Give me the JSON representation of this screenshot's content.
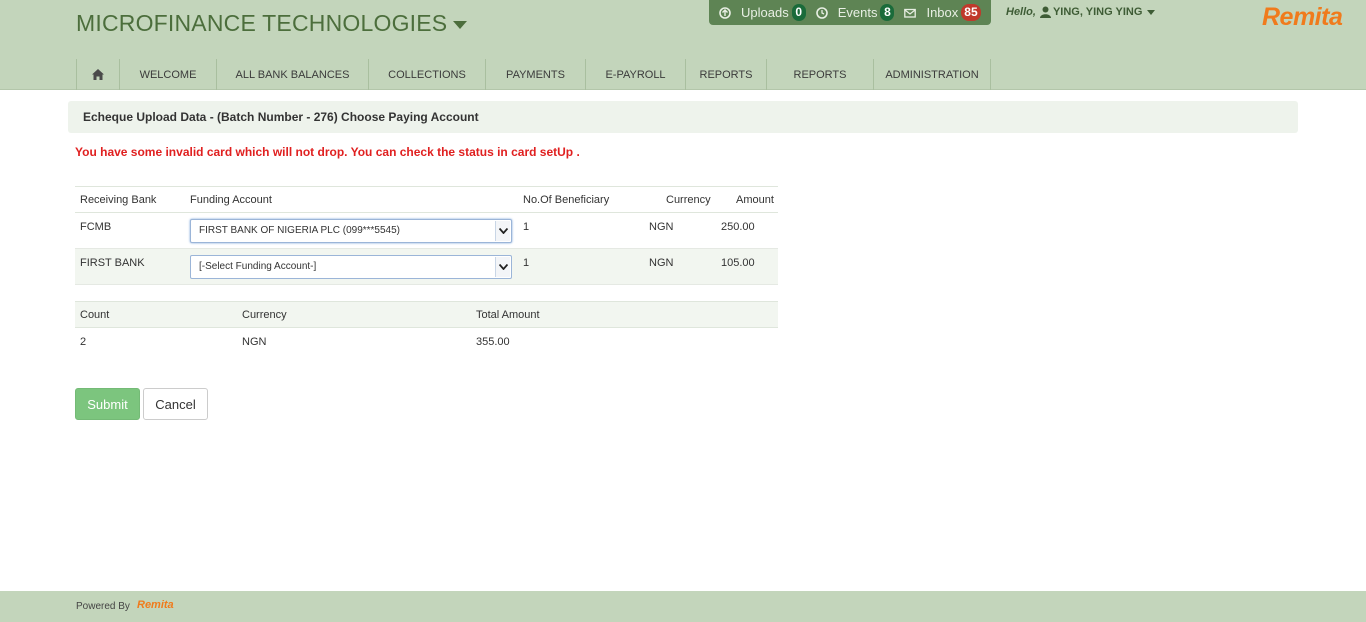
{
  "header": {
    "brand": "MICROFINANCE TECHNOLOGIES",
    "notifications": [
      {
        "label": "Uploads",
        "count": "0",
        "badge_color": "#1a6b3a"
      },
      {
        "label": "Events",
        "count": "8",
        "badge_color": "#1a6b3a"
      },
      {
        "label": "Inbox",
        "count": "85",
        "badge_color": "#c0392b"
      }
    ],
    "hello": "Hello,",
    "user_name": "YING, YING YING",
    "logo": "Remita"
  },
  "nav": {
    "items": [
      {
        "label": ""
      },
      {
        "label": "WELCOME"
      },
      {
        "label": "ALL BANK BALANCES"
      },
      {
        "label": "COLLECTIONS"
      },
      {
        "label": "PAYMENTS"
      },
      {
        "label": "E-PAYROLL"
      },
      {
        "label": "REPORTS"
      },
      {
        "label": "REPORTS"
      },
      {
        "label": "ADMINISTRATION"
      }
    ]
  },
  "page": {
    "title": "Echeque Upload Data - (Batch Number - 276) Choose Paying Account",
    "error": "You have some invalid card which will not drop. You can check the status in card setUp ."
  },
  "funding_table": {
    "headers": [
      "Receiving Bank",
      "Funding Account",
      "No.Of Beneficiary",
      "Currency",
      "Amount"
    ],
    "rows": [
      {
        "bank": "FCMB",
        "account": "FIRST BANK OF NIGERIA PLC (099***5545)",
        "beneficiaries": "1",
        "currency": "NGN",
        "amount": "250.00"
      },
      {
        "bank": "FIRST BANK",
        "account": "[-Select Funding Account-]",
        "beneficiaries": "1",
        "currency": "NGN",
        "amount": "105.00"
      }
    ]
  },
  "summary_table": {
    "headers": [
      "Count",
      "Currency",
      "Total Amount"
    ],
    "row": {
      "count": "2",
      "currency": "NGN",
      "total": "355.00"
    }
  },
  "buttons": {
    "submit": "Submit",
    "cancel": "Cancel"
  },
  "footer": {
    "powered_by": "Powered By",
    "logo": "Remita"
  },
  "colors": {
    "header_bg": "#c3d5bb",
    "brand_text": "#4c6e3c",
    "error_text": "#e02020",
    "submit_bg": "#7cc57e",
    "logo_orange": "#f07b1c"
  }
}
